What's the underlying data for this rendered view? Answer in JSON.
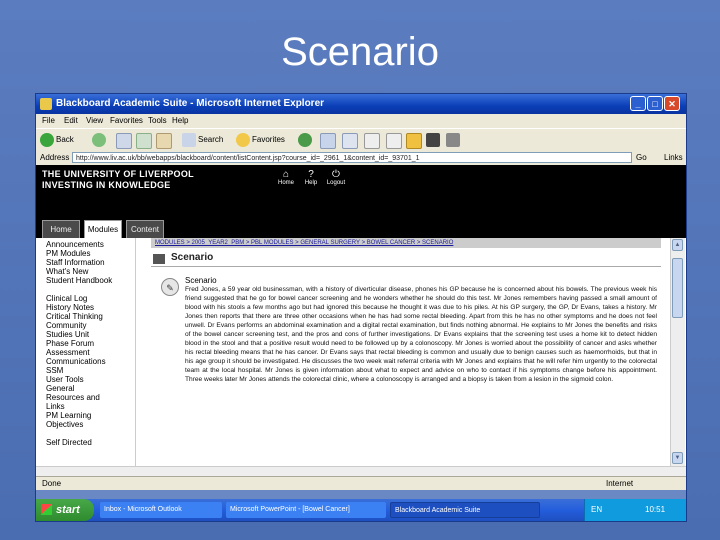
{
  "slide": {
    "title": "Scenario"
  },
  "window": {
    "title": "Blackboard Academic Suite - Microsoft Internet Explorer",
    "buttons": {
      "minimize": "_",
      "maximize": "□",
      "close": "✕"
    }
  },
  "menu": [
    "File",
    "Edit",
    "View",
    "Favorites",
    "Tools",
    "Help"
  ],
  "toolbar": {
    "back": "Back",
    "search": "Search",
    "favorites": "Favorites"
  },
  "address": {
    "label": "Address",
    "url": "http://www.liv.ac.uk/bb/webapps/blackboard/content/listContent.jsp?course_id=_2961_1&content_id=_93701_1",
    "go": "Go",
    "links": "Links"
  },
  "header": {
    "line1": "THE UNIVERSITY OF LIVERPOOL",
    "line2": "INVESTING IN KNOWLEDGE",
    "icons": [
      {
        "name": "home",
        "label": "Home"
      },
      {
        "name": "help",
        "label": "Help"
      },
      {
        "name": "logout",
        "label": "Logout"
      }
    ]
  },
  "tabs": [
    "Home",
    "Modules",
    "Content"
  ],
  "sidebar": {
    "items": [
      "Announcements",
      "PM Modules",
      "Staff Information",
      "What's New",
      "Student Handbook",
      "Clinical Log",
      "History Notes",
      "Critical Thinking",
      "Community Studies Unit",
      "Phase Forum",
      "Assessment",
      "Communications",
      "SSM",
      "User Tools",
      "General Resources and Links",
      "PM Learning Objectives",
      "Self Directed"
    ]
  },
  "main": {
    "breadcrumb": "MODULES > 2005_YEAR2_PBM > PBL MODULES > GENERAL SURGERY > BOWEL CANCER > SCENARIO",
    "page_title": "Scenario",
    "item_title": "Scenario",
    "item_body": "Fred Jones, a 59 year old businessman, with a history of diverticular disease, phones his GP because he is concerned about his bowels. The previous week his friend suggested that he go for bowel cancer screening and he wonders whether he should do this test. Mr Jones remembers having passed a small amount of blood with his stools a few months ago but had ignored this because he thought it was due to his piles. At his GP surgery, the GP, Dr Evans, takes a history. Mr Jones then reports that there are three other occasions when he has had some rectal bleeding. Apart from this he has no other symptoms and he does not feel unwell. Dr Evans performs an abdominal examination and a digital rectal examination, but finds nothing abnormal. He explains to Mr Jones the benefits and risks of the bowel cancer screening test, and the pros and cons of further investigations. Dr Evans explains that the screening test uses a home kit to detect hidden blood in the stool and that a positive result would need to be followed up by a colonoscopy. Mr Jones is worried about the possibility of cancer and asks whether his rectal bleeding means that he has cancer. Dr Evans says that rectal bleeding is common and usually due to benign causes such as haemorrhoids, but that in his age group it should be investigated. He discusses the two week wait referral criteria with Mr Jones and explains that he will refer him urgently to the colorectal team at the local hospital. Mr Jones is given information about what to expect and advice on who to contact if his symptoms change before his appointment. Three weeks later Mr Jones attends the colorectal clinic, where a colonoscopy is arranged and a biopsy is taken from a lesion in the sigmoid colon."
  },
  "status": {
    "left": "Done",
    "right": "Internet"
  },
  "taskbar": {
    "start": "start",
    "tasks": [
      "Inbox - Microsoft Outlook",
      "Microsoft PowerPoint - [Bowel Cancer]",
      "Blackboard Academic Suite"
    ],
    "lang": "EN",
    "clock": "10:51"
  }
}
